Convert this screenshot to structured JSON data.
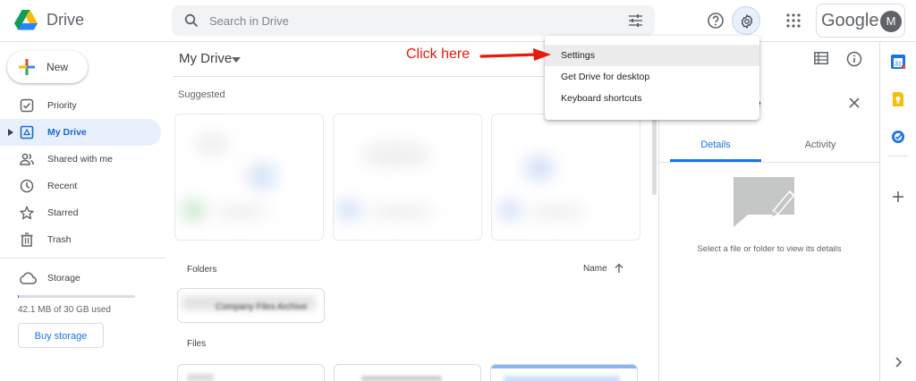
{
  "header": {
    "app_name": "Drive",
    "search_placeholder": "Search in Drive",
    "account_brand": "Google",
    "avatar_initial": "M",
    "logo_icon": "google-drive-logo",
    "icons": [
      "search-icon",
      "filter-options-icon",
      "help-icon",
      "gear-icon",
      "apps-grid-icon"
    ],
    "accent": "#1a73e8"
  },
  "sidebar": {
    "new_label": "New",
    "items": [
      {
        "label": "Priority",
        "icon": "priority-checkbox-icon",
        "active": false
      },
      {
        "label": "My Drive",
        "icon": "my-drive-icon",
        "active": true
      },
      {
        "label": "Shared with me",
        "icon": "people-icon",
        "active": false
      },
      {
        "label": "Recent",
        "icon": "clock-icon",
        "active": false
      },
      {
        "label": "Starred",
        "icon": "star-icon",
        "active": false
      },
      {
        "label": "Trash",
        "icon": "trash-icon",
        "active": false
      }
    ],
    "storage_label": "Storage",
    "storage_used": "42.1 MB of 30 GB used",
    "storage_fraction": 0.0014,
    "buy_label": "Buy storage"
  },
  "main": {
    "title": "My Drive",
    "suggested_label": "Suggested",
    "folders_label": "Folders",
    "sort_label": "Name",
    "folder_name": "Company Files Archive",
    "files_label": "Files"
  },
  "details": {
    "tabs": [
      "Details",
      "Activity"
    ],
    "empty_text": "Select a file or folder to view its details",
    "truncated_title_char": "e"
  },
  "menu": {
    "items": [
      "Settings",
      "Get Drive for desktop",
      "Keyboard shortcuts"
    ],
    "highlighted": "Settings"
  },
  "annotation": {
    "text": "Click here",
    "color": "#e8180c"
  },
  "right_rail": {
    "icons": [
      "calendar-icon",
      "keep-icon",
      "tasks-icon",
      "add-icon",
      "chevron-right-icon"
    ]
  }
}
